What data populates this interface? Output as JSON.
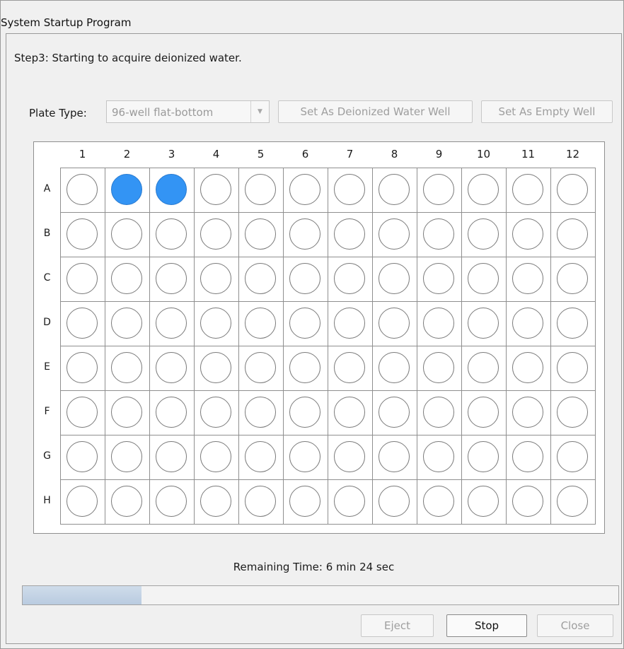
{
  "window": {
    "title": "System Startup Program"
  },
  "step_text": "Step3:  Starting to acquire deionized water.",
  "plate_type": {
    "label": "Plate Type:",
    "selected": "96-well flat-bottom"
  },
  "buttons": {
    "set_water": "Set As Deionized Water Well",
    "set_empty": "Set As Empty Well",
    "eject": "Eject",
    "stop": "Stop",
    "close": "Close"
  },
  "plate": {
    "columns": [
      "1",
      "2",
      "3",
      "4",
      "5",
      "6",
      "7",
      "8",
      "9",
      "10",
      "11",
      "12"
    ],
    "rows": [
      "A",
      "B",
      "C",
      "D",
      "E",
      "F",
      "G",
      "H"
    ],
    "filled_wells": [
      "A2",
      "A3"
    ],
    "fill_color": "#3394f4"
  },
  "status": {
    "remaining": "Remaining Time: 6 min 24 sec",
    "progress_fraction": 0.2
  }
}
